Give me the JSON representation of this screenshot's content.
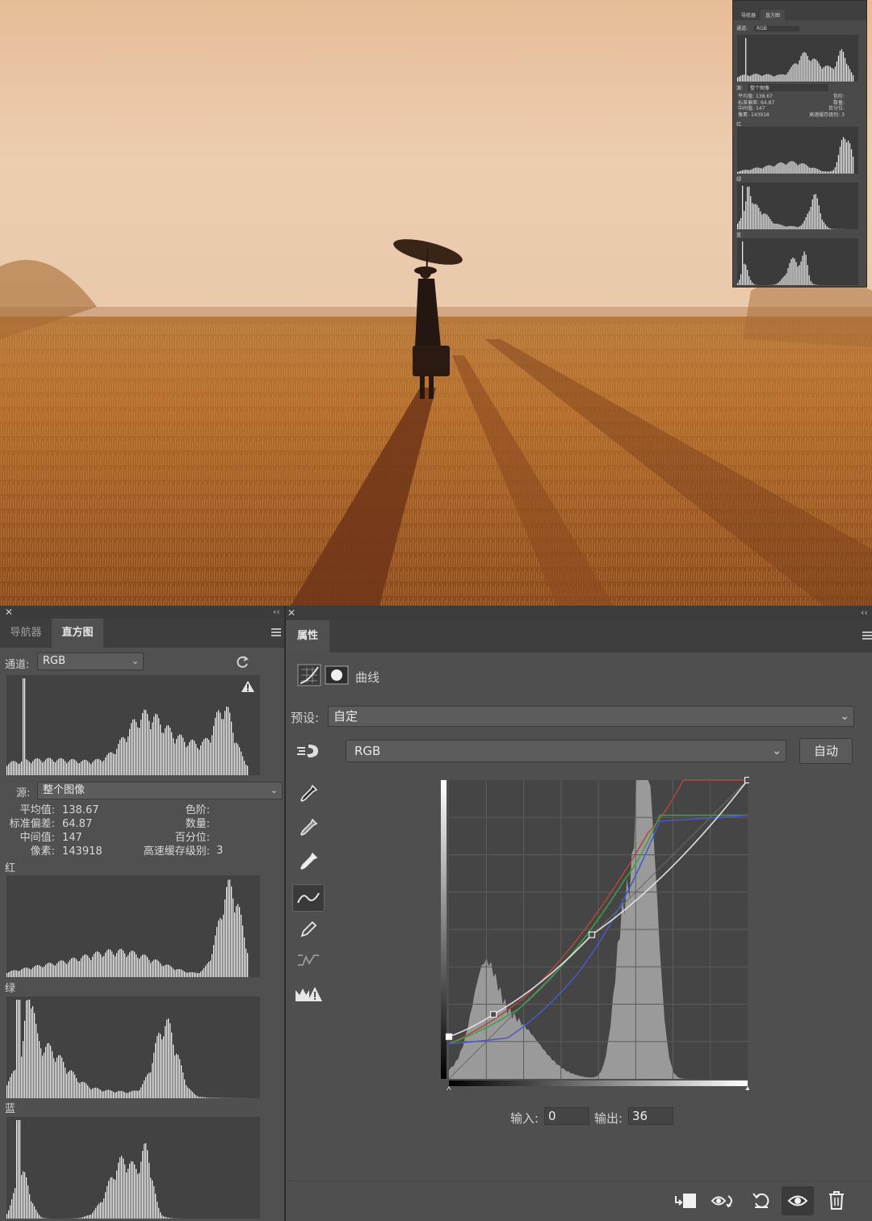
{
  "mini_panel": {
    "tabs": [
      "导航器",
      "直方图"
    ],
    "channel_label": "通道:",
    "channel_value": "RGB",
    "source_label": "源:",
    "source_value": "整个图像",
    "stats_left": [
      {
        "label": "平均值:",
        "value": "138.67"
      },
      {
        "label": "标准偏差:",
        "value": "64.87"
      },
      {
        "label": "中间值:",
        "value": "147"
      },
      {
        "label": "像素:",
        "value": "143918"
      }
    ],
    "stats_right": [
      {
        "label": "色阶:",
        "value": ""
      },
      {
        "label": "数量:",
        "value": ""
      },
      {
        "label": "百分位:",
        "value": ""
      },
      {
        "label": "高速缓存级别:",
        "value": "3"
      }
    ],
    "ch_red": "红",
    "ch_green": "绿",
    "ch_blue": "蓝"
  },
  "histogram_panel": {
    "tabs": [
      {
        "label": "导航器",
        "active": false
      },
      {
        "label": "直方图",
        "active": true
      }
    ],
    "channel_label": "通道:",
    "channel_value": "RGB",
    "source_label": "源:",
    "source_value": "整个图像",
    "stats_left": [
      {
        "label": "平均值:",
        "value": "138.67"
      },
      {
        "label": "标准偏差:",
        "value": "64.87"
      },
      {
        "label": "中间值:",
        "value": "147"
      },
      {
        "label": "像素:",
        "value": "143918"
      }
    ],
    "stats_right": [
      {
        "label": "色阶:",
        "value": ""
      },
      {
        "label": "数量:",
        "value": ""
      },
      {
        "label": "百分位:",
        "value": ""
      },
      {
        "label": "高速缓存级别:",
        "value": "3"
      }
    ],
    "red_label": "红",
    "green_label": "绿",
    "blue_label": "蓝"
  },
  "properties_panel": {
    "tab": "属性",
    "adjustment_name": "曲线",
    "preset_label": "预设:",
    "preset_value": "自定",
    "channel_value": "RGB",
    "auto_button": "自动",
    "input_label": "输入:",
    "input_value": "0",
    "output_label": "输出:",
    "output_value": "36"
  },
  "curves": {
    "composite_points": [
      [
        0,
        36
      ],
      [
        38,
        55
      ],
      [
        122,
        123
      ],
      [
        255,
        255
      ]
    ],
    "red_curve": [
      [
        0,
        30
      ],
      [
        65,
        70
      ],
      [
        170,
        210
      ],
      [
        200,
        255
      ],
      [
        255,
        255
      ]
    ],
    "green_curve": [
      [
        0,
        30
      ],
      [
        60,
        60
      ],
      [
        150,
        170
      ],
      [
        180,
        225
      ],
      [
        255,
        225
      ]
    ],
    "blue_curve": [
      [
        0,
        30
      ],
      [
        50,
        35
      ],
      [
        110,
        90
      ],
      [
        180,
        220
      ],
      [
        255,
        225
      ]
    ]
  },
  "colors": {
    "panel": "#505050",
    "panel_dark": "#3e3e3e",
    "hist_bg": "#424242",
    "curve_red": "#b0483a",
    "curve_green": "#3ea048",
    "curve_blue": "#4a58c8",
    "curve_main": "#e0e0e0"
  },
  "icons": [
    "close-icon",
    "collapse-icon",
    "panel-menu-icon",
    "refresh-icon",
    "warning-icon",
    "curves-adjust-icon",
    "mask-icon",
    "target-adjust-icon",
    "eyedropper-black-icon",
    "eyedropper-gray-icon",
    "eyedropper-white-icon",
    "curve-point-icon",
    "pencil-icon",
    "smooth-icon",
    "clipping-warning-icon",
    "clip-to-layer-icon",
    "view-previous-icon",
    "reset-icon",
    "visibility-icon",
    "trash-icon"
  ]
}
